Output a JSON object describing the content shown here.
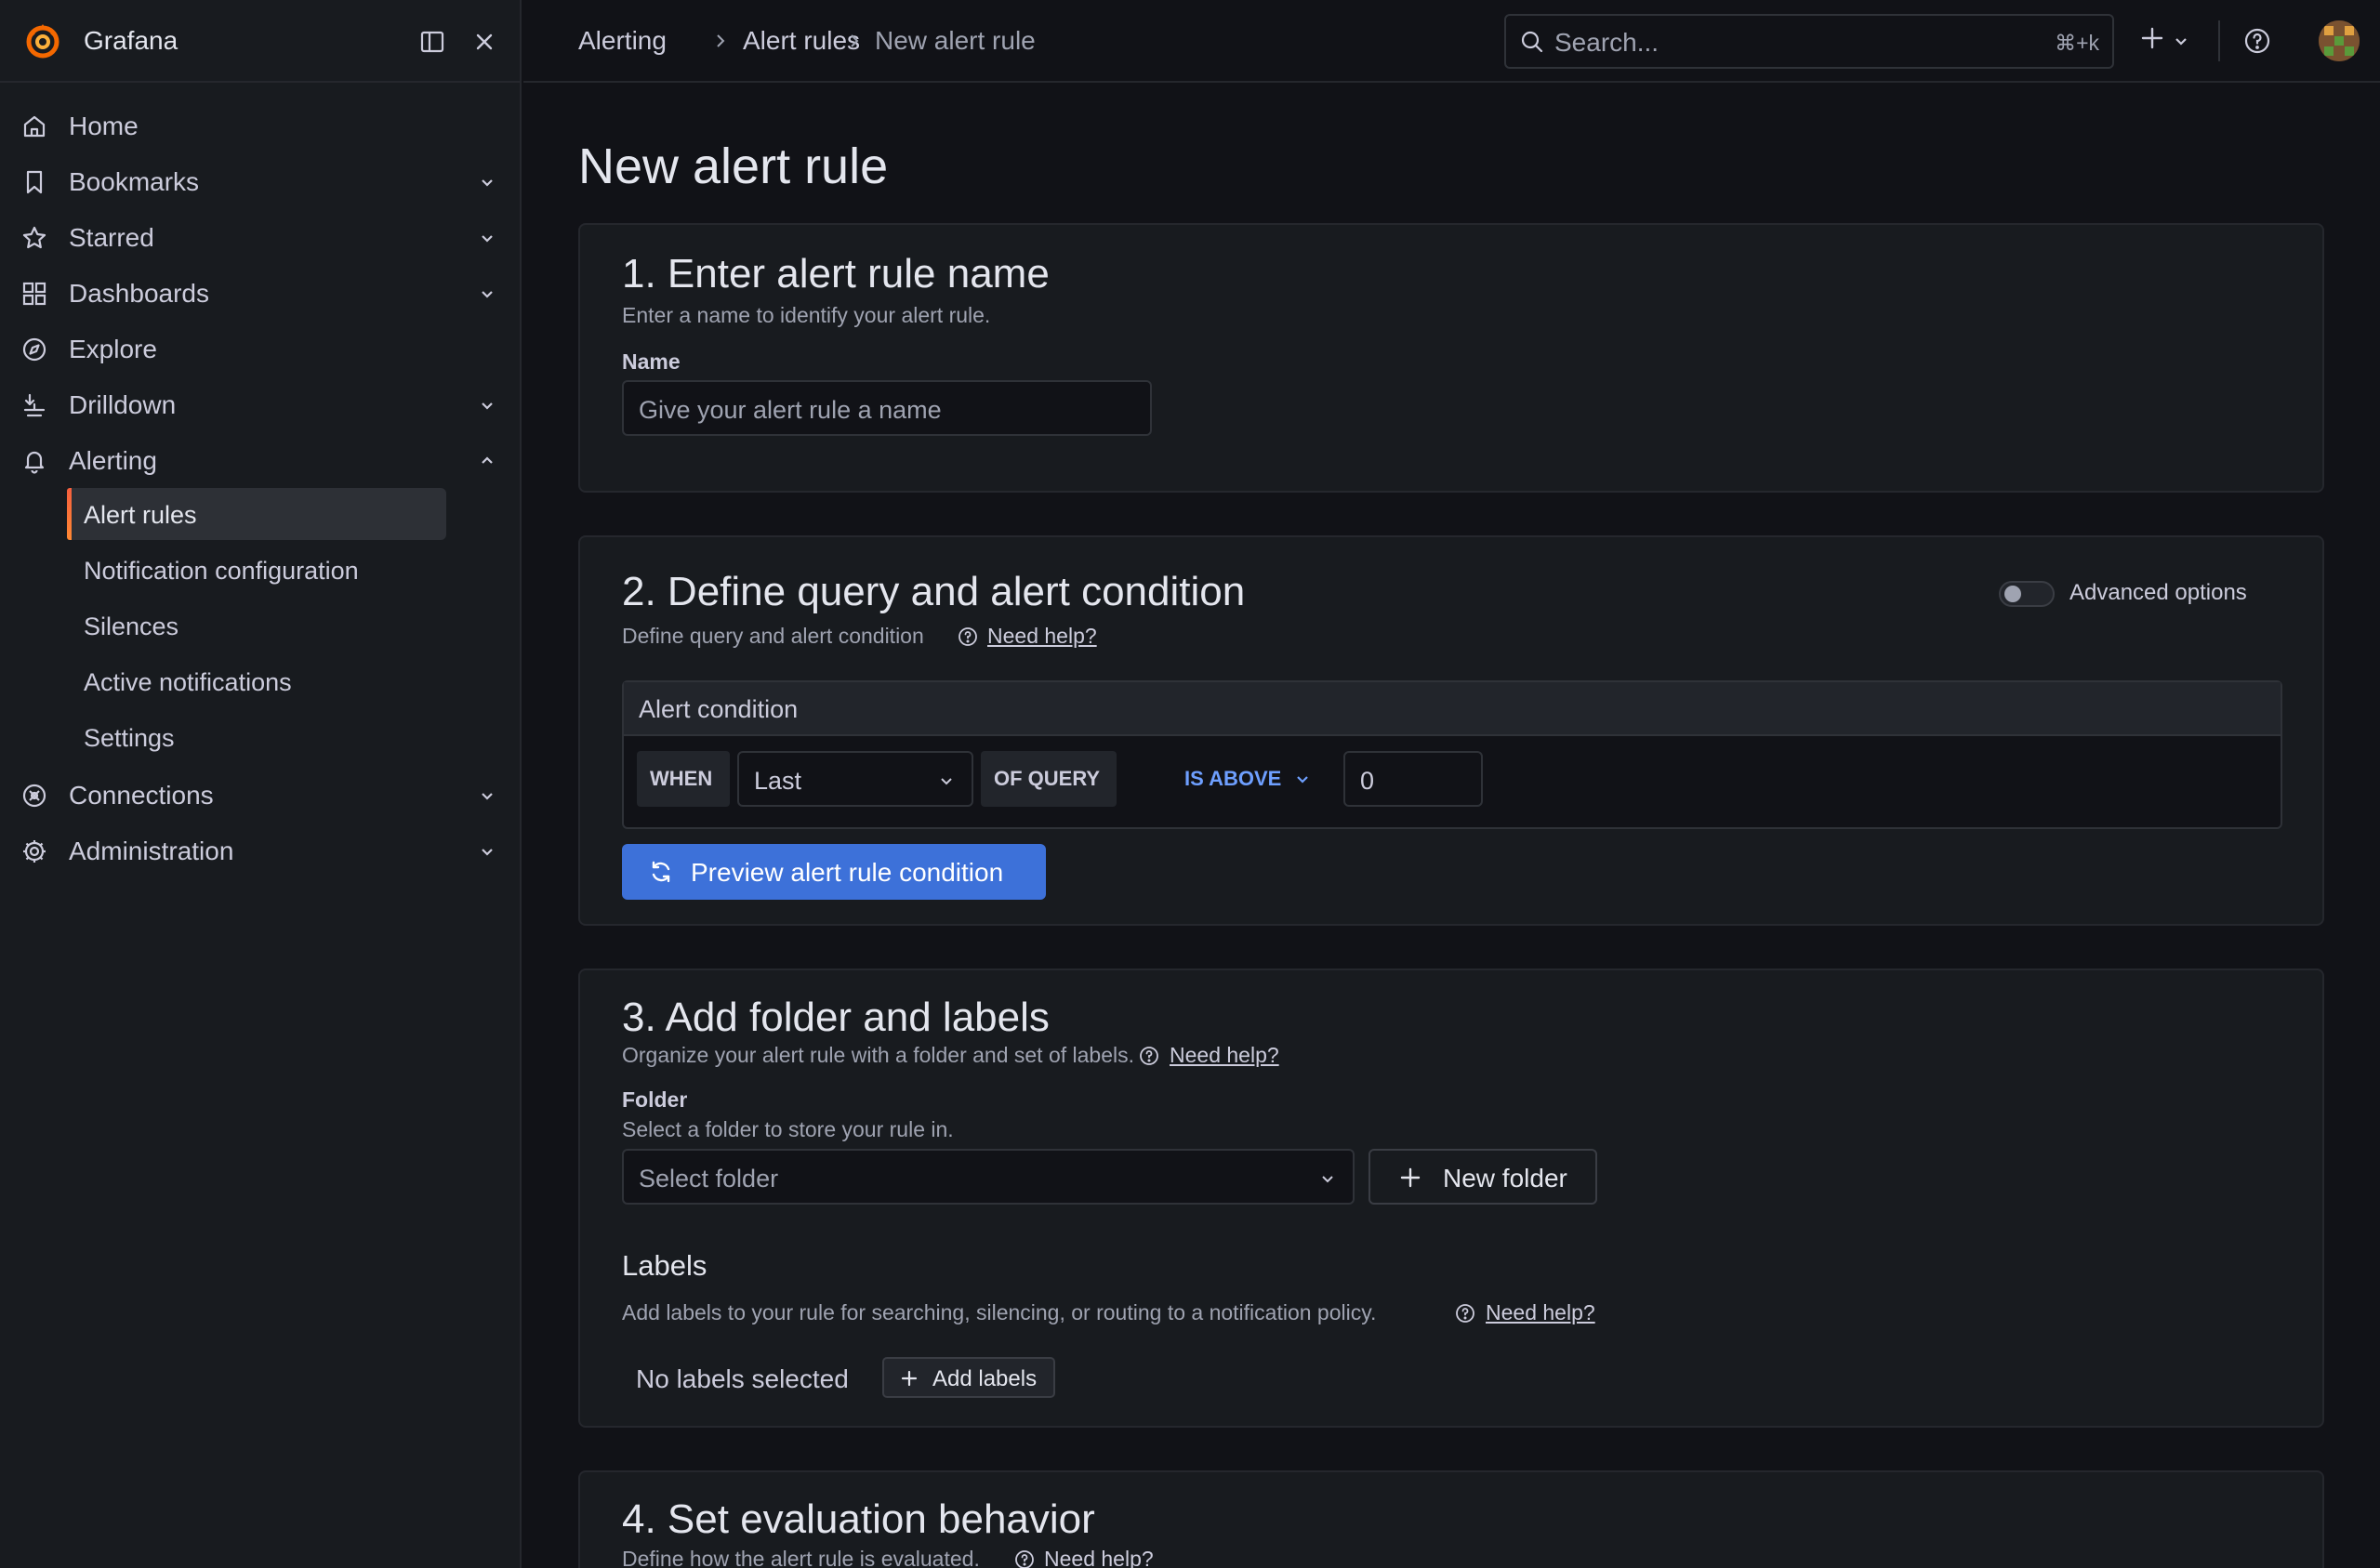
{
  "app": {
    "name": "Grafana"
  },
  "colors": {
    "accent": "#3d71d9",
    "brand": "#f55f3e",
    "link_blue": "#6e9fff"
  },
  "sidebar": {
    "items": [
      {
        "label": "Home",
        "icon": "home-icon"
      },
      {
        "label": "Bookmarks",
        "icon": "bookmark-icon"
      },
      {
        "label": "Starred",
        "icon": "star-icon"
      },
      {
        "label": "Dashboards",
        "icon": "apps-icon"
      },
      {
        "label": "Explore",
        "icon": "compass-icon"
      },
      {
        "label": "Drilldown",
        "icon": "drilldown-icon"
      },
      {
        "label": "Alerting",
        "icon": "bell-icon"
      },
      {
        "label": "Connections",
        "icon": "connections-icon"
      },
      {
        "label": "Administration",
        "icon": "gear-icon"
      }
    ],
    "alerting_subitems": [
      {
        "label": "Alert rules",
        "active": true
      },
      {
        "label": "Notification configuration"
      },
      {
        "label": "Silences"
      },
      {
        "label": "Active notifications"
      },
      {
        "label": "Settings"
      }
    ]
  },
  "topbar": {
    "breadcrumbs": [
      "Alerting",
      "Alert rules",
      "New alert rule"
    ],
    "search_placeholder": "Search...",
    "search_shortcut": "⌘+k"
  },
  "page": {
    "title": "New alert rule",
    "section1": {
      "title": "1. Enter alert rule name",
      "description": "Enter a name to identify your alert rule.",
      "name_label": "Name",
      "name_placeholder": "Give your alert rule a name"
    },
    "section2": {
      "title": "2. Define query and alert condition",
      "description": "Define query and alert condition",
      "help_link": "Need help?",
      "advanced_options_label": "Advanced options",
      "advanced_options_enabled": false,
      "condition_header": "Alert condition",
      "when_label": "WHEN",
      "reducer_value": "Last",
      "of_query_label": "OF QUERY",
      "operator_label": "IS ABOVE",
      "threshold_value": "0",
      "preview_button": "Preview alert rule condition"
    },
    "section3": {
      "title": "3. Add folder and labels",
      "description": "Organize your alert rule with a folder and set of labels.",
      "help_link": "Need help?",
      "folder_label": "Folder",
      "folder_description": "Select a folder to store your rule in.",
      "folder_placeholder": "Select folder",
      "new_folder_button": "New folder",
      "labels_heading": "Labels",
      "labels_description": "Add labels to your rule for searching, silencing, or routing to a notification policy.",
      "labels_help_link": "Need help?",
      "no_labels_text": "No labels selected",
      "add_labels_button": "Add labels"
    },
    "section4": {
      "title": "4. Set evaluation behavior",
      "description": "Define how the alert rule is evaluated.",
      "help_link": "Need help?"
    }
  }
}
